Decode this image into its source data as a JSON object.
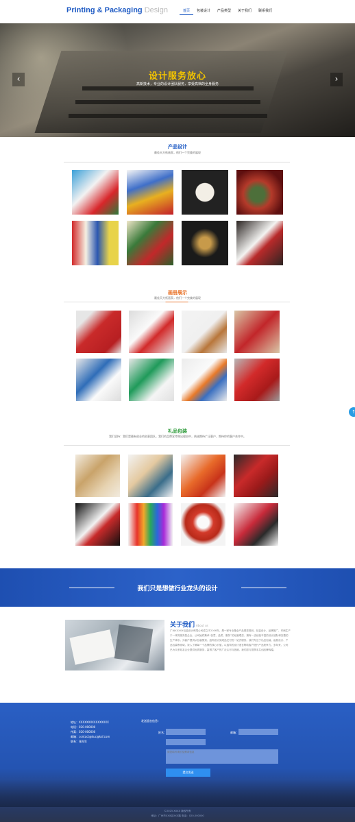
{
  "header": {
    "logo_main": "Printing & Packaging",
    "logo_accent": "Design",
    "nav": [
      "首页",
      "包装设计",
      "产品类型",
      "关于我们",
      "联系我们"
    ]
  },
  "hero": {
    "title": "设计服务放心",
    "subtitle": "高新技术，专业的设计团队服务，享受高档的全身服务",
    "prev_icon": "‹",
    "next_icon": "›"
  },
  "sections": {
    "product": {
      "title": "产品设计",
      "subtitle": "最佳天方纸画家，他们一个完美的展现",
      "color": "#1f5bc4"
    },
    "album": {
      "title": "画册展示",
      "subtitle": "最佳天方纸画家，他们一个完美的展现",
      "color": "#e8732a"
    },
    "gift": {
      "title": "礼品包装",
      "subtitle": "我们坚持：我们是最有创业的创意团队，我们的品牌宣传做出理由中，热诚期待广泛客户，期待你的客户合作中。",
      "color": "#2e9b3a"
    }
  },
  "banner": {
    "title": "我们只是想做行业龙头的设计"
  },
  "about": {
    "title": "关于我们",
    "title_en": "About us",
    "text": "广州XXXXX包装设计有限公司成立于2006年，是一家专业集全产品视觉规划、包装设计、品牌推广、印刷生产于一体的服务型企业。公司始终秉承“创意、品质、服务”的经营理念，拥有一支经验丰富的设计团队和完善的生产体系，为客户提供从包装策划、结构设计到成品交付的一站式服务。我们专注于礼品包装、画册设计、产品包装等领域，深入了解每一个品牌的核心价值，以独特的设计语言帮助客户提升产品竞争力。多年来，公司已为众多知名企业提供优质服务，赢得了客户的广泛认可与信赖。我们愿与您携手共创品牌辉煌。"
  },
  "footer": {
    "contact": [
      "地址：XXXXXXXXXXXXXXXX",
      "电话：020-000000",
      "传真：020-000000",
      "邮箱：contact@kuc@ksf.com",
      "联系：张先生"
    ],
    "form_title": "发送留言信息：",
    "name_label": "姓名：",
    "phone_label": "邮箱：",
    "message_placeholder": "请您填写询价及需求信息",
    "submit_label": "提交发送",
    "copyright_1": "©2025 XXXX 版权所有",
    "copyright_2": "地址：广州市XXX区XXX路 电话：020-000000"
  },
  "side_button": {
    "icon": "↑"
  }
}
